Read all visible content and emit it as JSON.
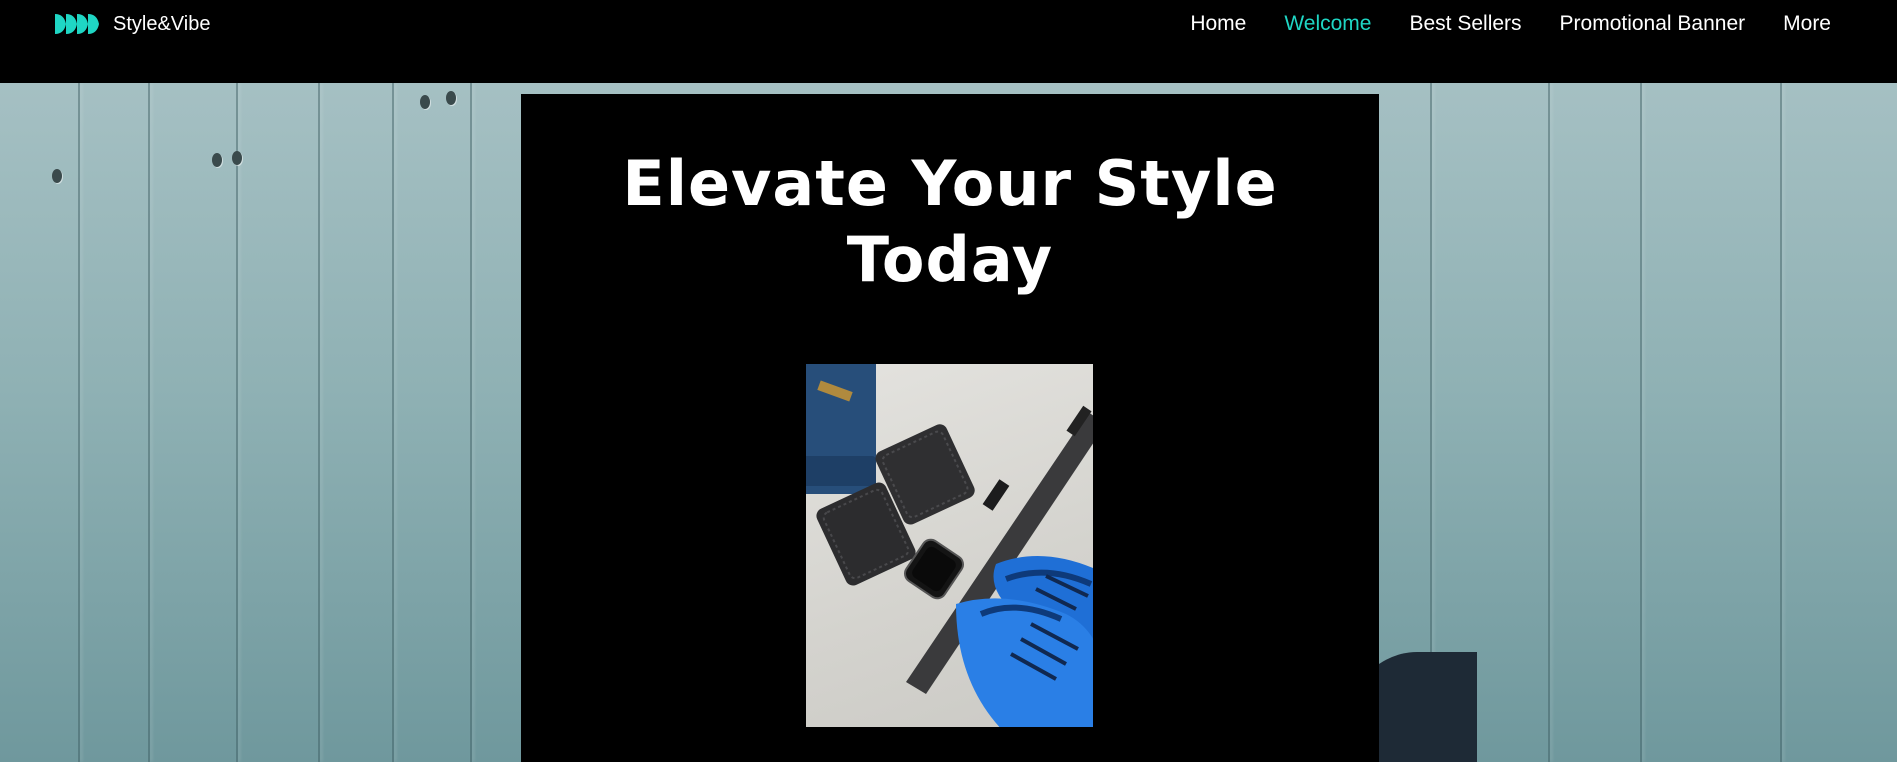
{
  "brand": {
    "name": "Style&Vibe",
    "logo_icon": "play-arrows-logo-icon",
    "accent_color": "#1fd6c4"
  },
  "nav": {
    "items": [
      {
        "label": "Home",
        "active": false
      },
      {
        "label": "Welcome",
        "active": true
      },
      {
        "label": "Best Sellers",
        "active": false
      },
      {
        "label": "Promotional Banner",
        "active": false
      },
      {
        "label": "More",
        "active": false
      }
    ]
  },
  "hero": {
    "headline": "Elevate Your Style Today",
    "background_color": "#000000",
    "text_color": "#ffffff"
  }
}
